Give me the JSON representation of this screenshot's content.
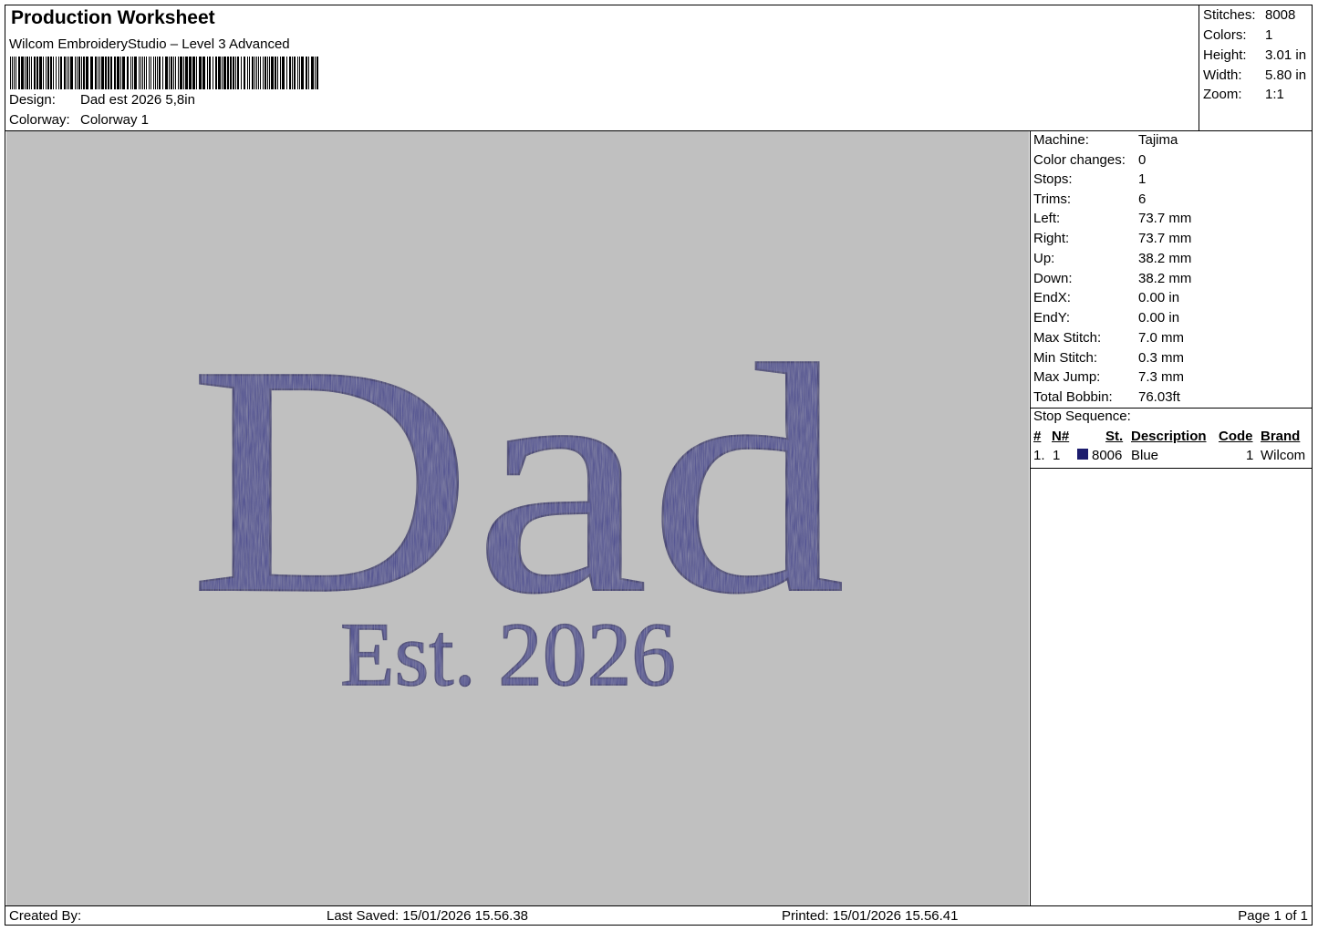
{
  "header": {
    "title": "Production Worksheet",
    "software": "Wilcom EmbroideryStudio – Level 3 Advanced",
    "design_label": "Design:",
    "design_value": "Dad est 2026 5,8in",
    "colorway_label": "Colorway:",
    "colorway_value": "Colorway 1"
  },
  "stats": [
    {
      "label": "Stitches:",
      "value": "8008"
    },
    {
      "label": "Colors:",
      "value": "1"
    },
    {
      "label": "Height:",
      "value": "3.01 in"
    },
    {
      "label": "Width:",
      "value": "5.80 in"
    },
    {
      "label": "Zoom:",
      "value": "1:1"
    }
  ],
  "properties": [
    {
      "label": "Machine:",
      "value": "Tajima"
    },
    {
      "label": "Color changes:",
      "value": "0"
    },
    {
      "label": "Stops:",
      "value": "1"
    },
    {
      "label": "Trims:",
      "value": "6"
    },
    {
      "label": "Left:",
      "value": "73.7 mm"
    },
    {
      "label": "Right:",
      "value": "73.7 mm"
    },
    {
      "label": "Up:",
      "value": "38.2 mm"
    },
    {
      "label": "Down:",
      "value": "38.2 mm"
    },
    {
      "label": "EndX:",
      "value": "0.00 in"
    },
    {
      "label": "EndY:",
      "value": "0.00 in"
    },
    {
      "label": "Max Stitch:",
      "value": "7.0 mm"
    },
    {
      "label": "Min Stitch:",
      "value": "0.3 mm"
    },
    {
      "label": "Max Jump:",
      "value": "7.3 mm"
    },
    {
      "label": "Total Bobbin:",
      "value": "76.03ft"
    }
  ],
  "stop_sequence": {
    "title": "Stop Sequence:",
    "columns": [
      "#",
      "N#",
      "St.",
      "Description",
      "Code",
      "Brand"
    ],
    "rows": [
      {
        "index": "1.",
        "n": "1",
        "swatch_color": "#1c1c6e",
        "st": "8006",
        "description": "Blue",
        "code": "1",
        "brand": "Wilcom"
      }
    ]
  },
  "design": {
    "main_text": "Dad",
    "sub_text": "Est. 2026",
    "thread_color": "#4a4891",
    "background_color": "#c0c0c0"
  },
  "footer": {
    "created_by": "Created By:",
    "last_saved": "Last Saved: 15/01/2026 15.56.38",
    "printed": "Printed: 15/01/2026 15.56.41",
    "page": "Page 1 of 1"
  }
}
